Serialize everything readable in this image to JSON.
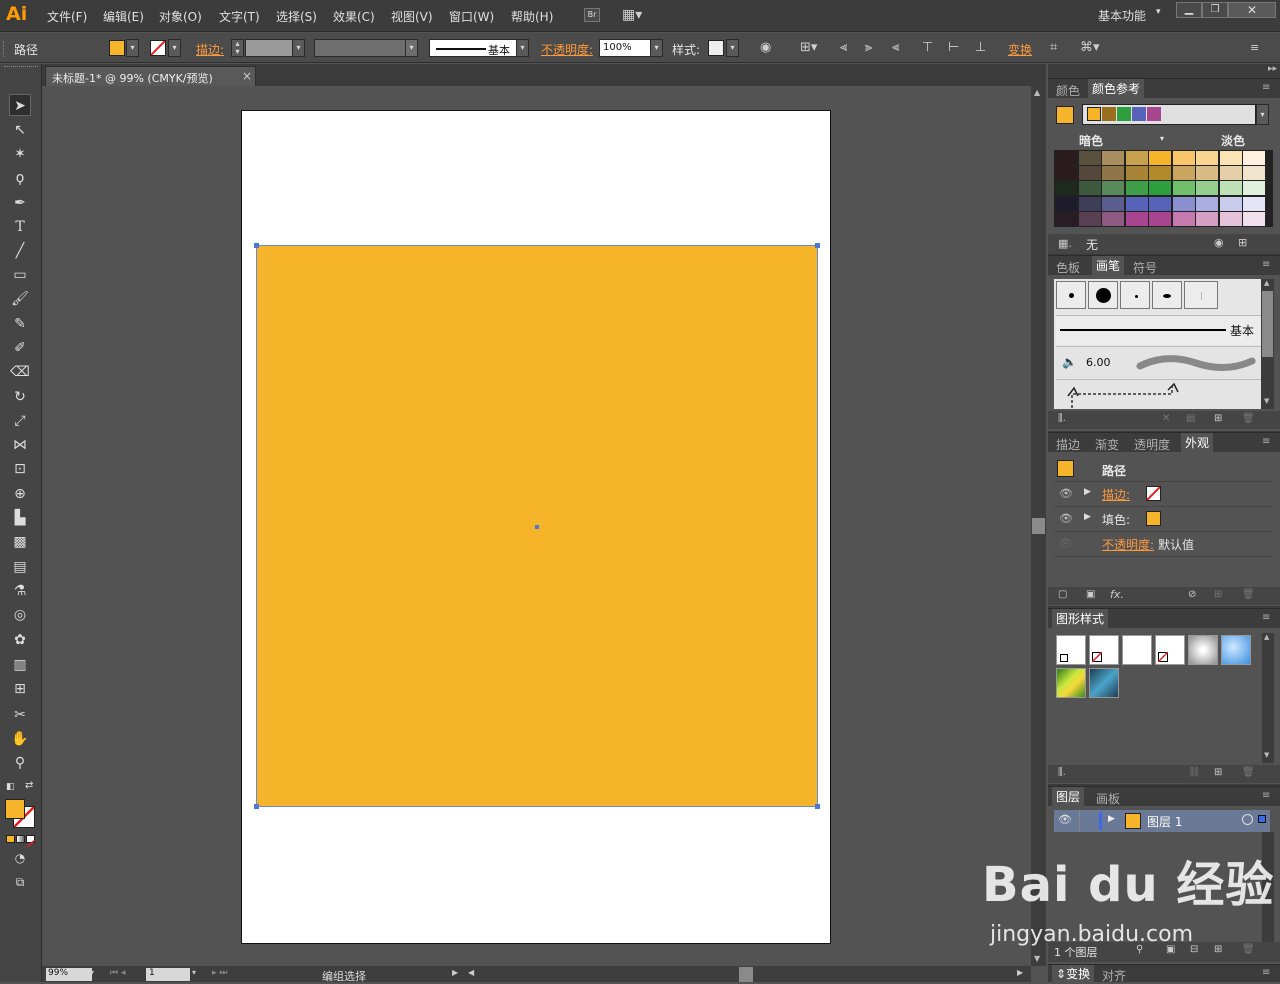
{
  "app": {
    "logo": "Ai",
    "workspace": "基本功能",
    "workspace_arrow": "▾"
  },
  "menu": [
    "文件(F)",
    "编辑(E)",
    "对象(O)",
    "文字(T)",
    "选择(S)",
    "效果(C)",
    "视图(V)",
    "窗口(W)",
    "帮助(H)"
  ],
  "bridge": "Br",
  "control": {
    "object_type": "路径",
    "stroke_label": "描边:",
    "brush_label": "基本",
    "opacity_label": "不透明度:",
    "opacity_value": "100%",
    "style_label": "样式:",
    "transform_label": "变换"
  },
  "colors": {
    "fill": "#f6b42a",
    "selection": "#4a7ad8",
    "artboard": "#ffffff",
    "ui_dark": "#3c3c3c",
    "ui_mid": "#535353",
    "accent": "#ff9a3c"
  },
  "document": {
    "tab_title": "未标题-1* @ 99% (CMYK/预览)",
    "close": "×"
  },
  "status": {
    "zoom": "99%",
    "page": "1",
    "mode": "编组选择"
  },
  "color_panel": {
    "tab1": "颜色",
    "tab2": "颜色参考",
    "dark_label": "暗色",
    "light_label": "淡色",
    "none_label": "无",
    "harmony": [
      "#f6b42a",
      "#9b6d1f",
      "#2f9e3f",
      "#5763b8",
      "#a8458f"
    ],
    "grid": [
      [
        "#2a1c1c",
        "#5a503e",
        "#a88e5e",
        "#c8a14e",
        "#f6b42a",
        "#f8c668",
        "#f9d592",
        "#fbe3b8",
        "#fdf2de"
      ],
      [
        "#2a1c1c",
        "#55483a",
        "#8f7547",
        "#a98337",
        "#b18a2c",
        "#c9a560",
        "#d8bb85",
        "#e5cfa9",
        "#f1e4cf"
      ],
      [
        "#1e2a1e",
        "#3e5a3e",
        "#5a8a5a",
        "#3f9e4a",
        "#2f9e3f",
        "#6fbf6b",
        "#95cf8f",
        "#bde0b6",
        "#e0f0dc"
      ],
      [
        "#1c1c2a",
        "#3e3e5a",
        "#5a5e8e",
        "#5763b8",
        "#5763b8",
        "#8a8fd0",
        "#a9ade0",
        "#c8cbec",
        "#e4e5f6"
      ],
      [
        "#2a1c24",
        "#5a3e52",
        "#8e5a82",
        "#a8458f",
        "#a8458f",
        "#c57aad",
        "#d59ec4",
        "#e5c1da",
        "#f2e1ed"
      ]
    ]
  },
  "brush_panel": {
    "tab1": "色板",
    "tab2": "画笔",
    "tab3": "符号",
    "basic_label": "基本",
    "size_value": "6.00"
  },
  "appearance": {
    "tab1": "描边",
    "tab2": "渐变",
    "tab3": "透明度",
    "tab4": "外观",
    "title": "路径",
    "stroke_label": "描边:",
    "fill_label": "填色:",
    "opacity_label": "不透明度:",
    "opacity_value": "默认值",
    "fx": "fx."
  },
  "graphic_styles": {
    "title": "图形样式"
  },
  "layers": {
    "tab1": "图层",
    "tab2": "画板",
    "layer_name": "图层 1",
    "count": "1 个图层"
  },
  "bottom_tabs": {
    "tab1": "变换",
    "tab2": "对齐"
  },
  "watermark": {
    "brand": "Bai du 经验",
    "url": "jingyan.baidu.com"
  }
}
